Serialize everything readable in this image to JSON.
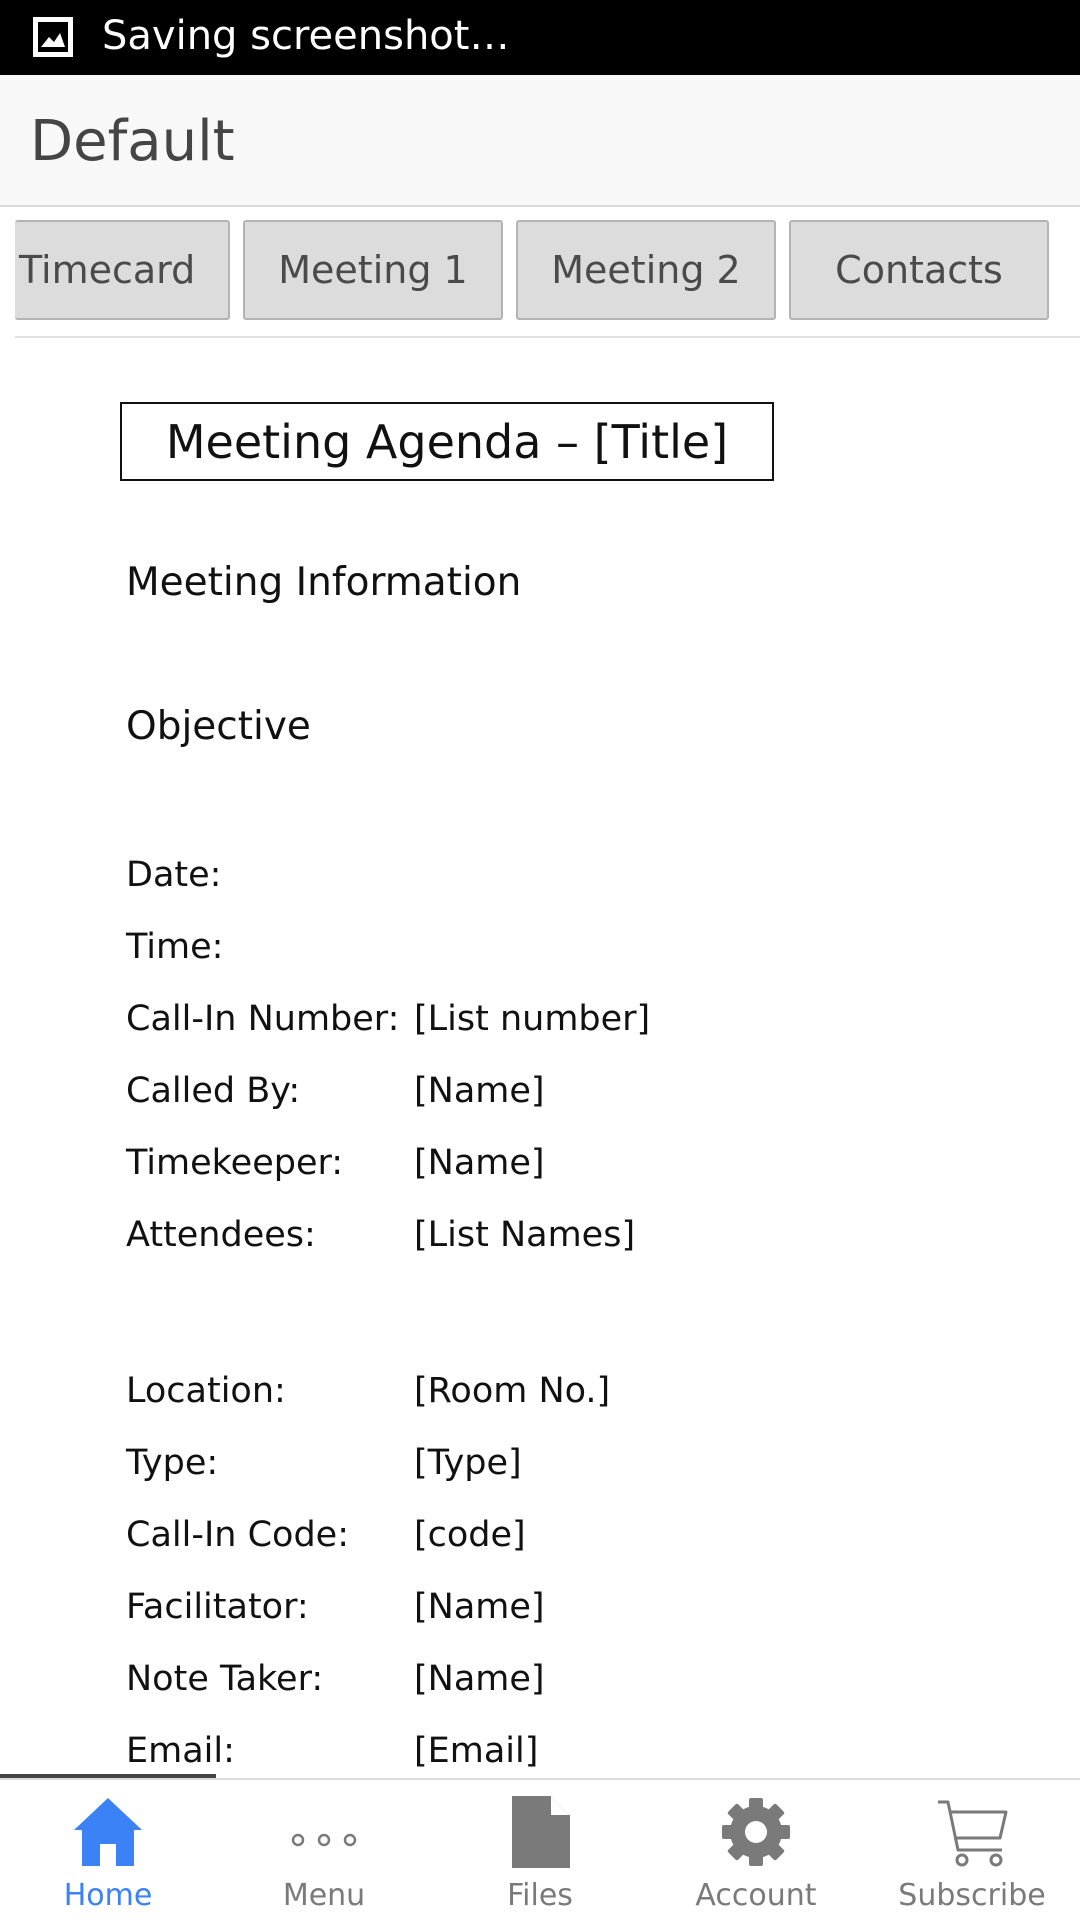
{
  "status_bar": {
    "text": "Saving screenshot…"
  },
  "app_bar": {
    "title": "Default"
  },
  "tabs": [
    {
      "label": "Timecard"
    },
    {
      "label": "Meeting 1"
    },
    {
      "label": "Meeting 2"
    },
    {
      "label": "Contacts"
    }
  ],
  "document": {
    "title": "Meeting Agenda – [Title]",
    "meeting_information": "Meeting Information",
    "objective": "Objective",
    "fields_group1": [
      {
        "label": "Date:",
        "value": ""
      },
      {
        "label": "Time:",
        "value": ""
      },
      {
        "label": "Call-In Number:",
        "value": "[List number]"
      },
      {
        "label": "Called By:",
        "value": "[Name]"
      },
      {
        "label": "Timekeeper:",
        "value": "[Name]"
      },
      {
        "label": "Attendees:",
        "value": "[List Names]"
      }
    ],
    "fields_group2": [
      {
        "label": "Location:",
        "value": "[Room No.]"
      },
      {
        "label": "Type:",
        "value": "[Type]"
      },
      {
        "label": "Call-In Code:",
        "value": "[code]"
      },
      {
        "label": "Facilitator:",
        "value": "[Name]"
      },
      {
        "label": "Note Taker:",
        "value": "[Name]"
      },
      {
        "label": "Email:",
        "value": "[Email]"
      }
    ]
  },
  "bottom_nav": [
    {
      "label": "Home",
      "icon": "home-icon",
      "active": true
    },
    {
      "label": "Menu",
      "icon": "more-dots-icon",
      "active": false
    },
    {
      "label": "Files",
      "icon": "file-icon",
      "active": false
    },
    {
      "label": "Account",
      "icon": "gear-icon",
      "active": false
    },
    {
      "label": "Subscribe",
      "icon": "cart-icon",
      "active": false
    }
  ],
  "colors": {
    "active": "#3b82f6",
    "inactive": "#7a7a7a",
    "tab_bg": "#dcdcdc",
    "app_bar_bg": "#f8f8f8"
  }
}
